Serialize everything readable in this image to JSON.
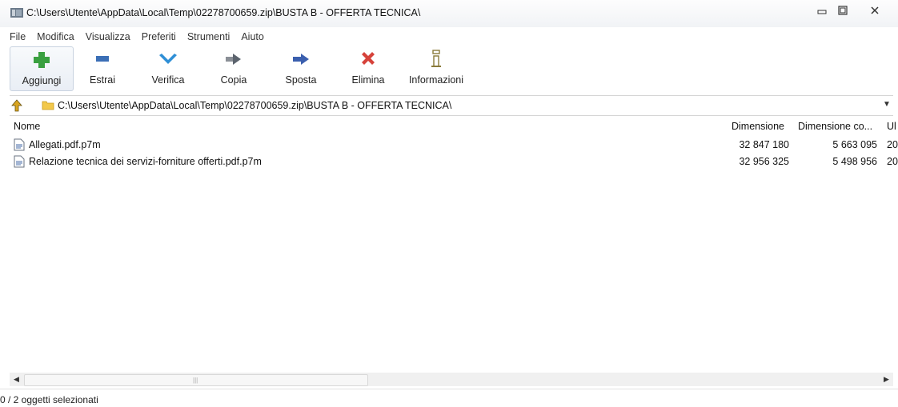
{
  "window": {
    "title": "C:\\Users\\Utente\\AppData\\Local\\Temp\\02278700659.zip\\BUSTA B - OFFERTA TECNICA\\"
  },
  "menu": [
    "File",
    "Modifica",
    "Visualizza",
    "Preferiti",
    "Strumenti",
    "Aiuto"
  ],
  "toolbar": [
    {
      "label": "Aggiungi",
      "icon": "plus-icon"
    },
    {
      "label": "Estrai",
      "icon": "minus-icon"
    },
    {
      "label": "Verifica",
      "icon": "check-icon"
    },
    {
      "label": "Copia",
      "icon": "copy-arrow-icon"
    },
    {
      "label": "Sposta",
      "icon": "move-arrow-icon"
    },
    {
      "label": "Elimina",
      "icon": "delete-x-icon"
    },
    {
      "label": "Informazioni",
      "icon": "info-icon"
    }
  ],
  "address": {
    "path": "C:\\Users\\Utente\\AppData\\Local\\Temp\\02278700659.zip\\BUSTA B - OFFERTA TECNICA\\"
  },
  "columns": {
    "name": "Nome",
    "size": "Dimensione",
    "compressed": "Dimensione co...",
    "extra": "Ul"
  },
  "files": [
    {
      "name": "Allegati.pdf.p7m",
      "size": "32 847 180",
      "compressed": "5 663 095",
      "extra": "20"
    },
    {
      "name": "Relazione tecnica dei servizi-forniture offerti.pdf.p7m",
      "size": "32 956 325",
      "compressed": "5 498 956",
      "extra": "20"
    }
  ],
  "status": "0 / 2 oggetti selezionati",
  "colors": {
    "add": "#3aa040",
    "extract": "#3b6fb6",
    "verify": "#2f8fd6",
    "delete": "#d6423a"
  }
}
